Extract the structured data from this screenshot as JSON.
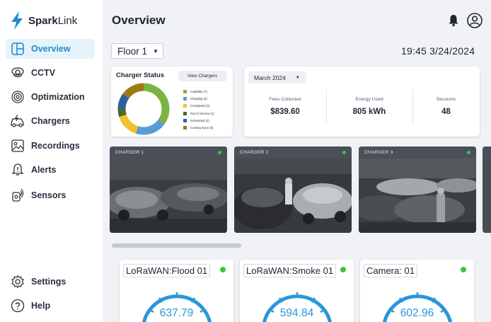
{
  "brand": {
    "name_bold": "Spark",
    "name_light": "Link"
  },
  "nav": {
    "items": [
      {
        "label": "Overview",
        "icon": "layout-icon",
        "active": true
      },
      {
        "label": "CCTV",
        "icon": "cctv-camera-icon"
      },
      {
        "label": "Optimization",
        "icon": "optimization-icon"
      },
      {
        "label": "Chargers",
        "icon": "charger-car-icon"
      },
      {
        "label": "Recordings",
        "icon": "image-icon"
      },
      {
        "label": "Alerts",
        "icon": "alert-icon"
      },
      {
        "label": "Sensors",
        "icon": "sensor-icon"
      }
    ],
    "bottom": [
      {
        "label": "Settings",
        "icon": "gear-icon"
      },
      {
        "label": "Help",
        "icon": "help-icon"
      }
    ]
  },
  "header": {
    "title": "Overview"
  },
  "floor_select": {
    "value": "Floor 1"
  },
  "clock": {
    "text": "19:45 3/24/2024"
  },
  "charger_status": {
    "title": "Charger Status",
    "button_label": "View Chargers",
    "legend": [
      {
        "label": "Available (7)",
        "count": 7,
        "color": "#7cb342"
      },
      {
        "label": "Charging (4)",
        "count": 4,
        "color": "#5b9bd5"
      },
      {
        "label": "Completed (3)",
        "count": 3,
        "color": "#f2c12e"
      },
      {
        "label": "Out of Service (1)",
        "count": 1,
        "color": "#4a6b2a"
      },
      {
        "label": "Scheduled (2)",
        "count": 2,
        "color": "#2f5f9e"
      },
      {
        "label": "Coming Soon (3)",
        "count": 3,
        "color": "#9c7a14"
      }
    ]
  },
  "stats": {
    "month": "March 2024",
    "items": [
      {
        "label": "Fees Collected",
        "value": "$839.60"
      },
      {
        "label": "Energy Used",
        "value": "805 kWh"
      },
      {
        "label": "Sessions",
        "value": "48"
      }
    ]
  },
  "cameras": [
    {
      "name": "CHARGER 1",
      "status_color": "#3cc43c"
    },
    {
      "name": "CHARGER 2",
      "status_color": "#3cc43c"
    },
    {
      "name": "CHARGER 3",
      "status_color": "#3cc43c"
    }
  ],
  "sensors": [
    {
      "name": "LoRaWAN:Flood 01",
      "value": "637.79",
      "status_color": "#3cc43c"
    },
    {
      "name": "LoRaWAN:Smoke 01",
      "value": "594.84",
      "status_color": "#3cc43c"
    },
    {
      "name": "Camera: 01",
      "value": "602.96",
      "status_color": "#3cc43c"
    }
  ],
  "colors": {
    "accent": "#1d8fcf",
    "gauge": "#2b96d9",
    "status_ok": "#3cc43c"
  }
}
